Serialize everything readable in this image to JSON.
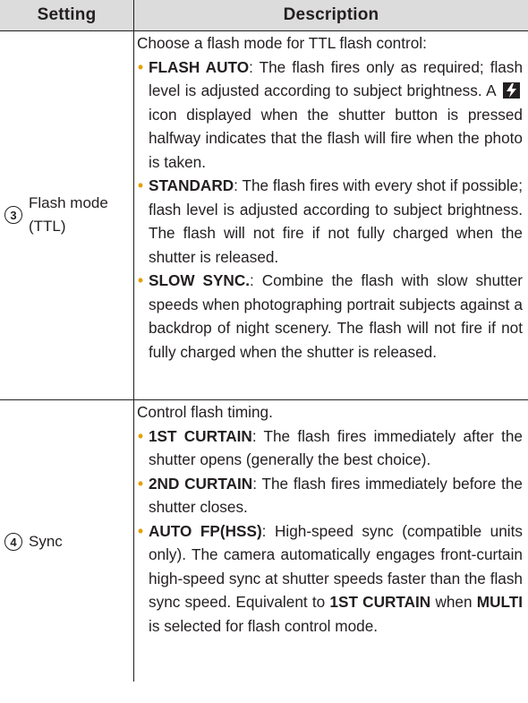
{
  "header": {
    "setting": "Setting",
    "description": "Description"
  },
  "rows": [
    {
      "number": "3",
      "setting_line1": "Flash mode",
      "setting_line2": "(TTL)",
      "intro": "Choose a flash mode for TTL flash control:",
      "items": [
        {
          "term": "FLASH AUTO",
          "text_before_icon": ": The flash fires only as required; flash level is adjusted according to subject brightness. A ",
          "icon": "flash-icon",
          "text_after_icon": " icon displayed when the shutter button is pressed halfway indicates that the flash will fire when the photo is taken."
        },
        {
          "term": "STANDARD",
          "text": ": The flash fires with every shot if possible; flash level is adjusted according to subject brightness. The flash will not fire if not fully charged when the shutter is released."
        },
        {
          "term": "SLOW SYNC.",
          "text": ": Combine the flash with slow shutter speeds when photographing portrait subjects against a backdrop of night scenery. The flash will not fire if not fully charged when the shutter is released."
        }
      ]
    },
    {
      "number": "4",
      "setting_line1": "Sync",
      "intro": "Control flash timing.",
      "items": [
        {
          "term": "1ST CURTAIN",
          "text": ": The flash fires immediately after the shutter opens (generally the best choice)."
        },
        {
          "term": "2ND CURTAIN",
          "text": ": The flash fires immediately before the shutter closes."
        },
        {
          "term": "AUTO FP(HSS)",
          "text": ": High-speed sync (compatible units only). The camera automatically engages front-curtain high-speed sync at shutter speeds faster than the flash sync speed. Equivalent to ",
          "term2": "1ST CURTAIN",
          "text2": " when ",
          "term3": "MULTI",
          "text3": " is selected for flash control mode."
        }
      ]
    }
  ],
  "colors": {
    "header_bg": "#dcdcdc",
    "bullet": "#e3a000",
    "text": "#231f20"
  }
}
